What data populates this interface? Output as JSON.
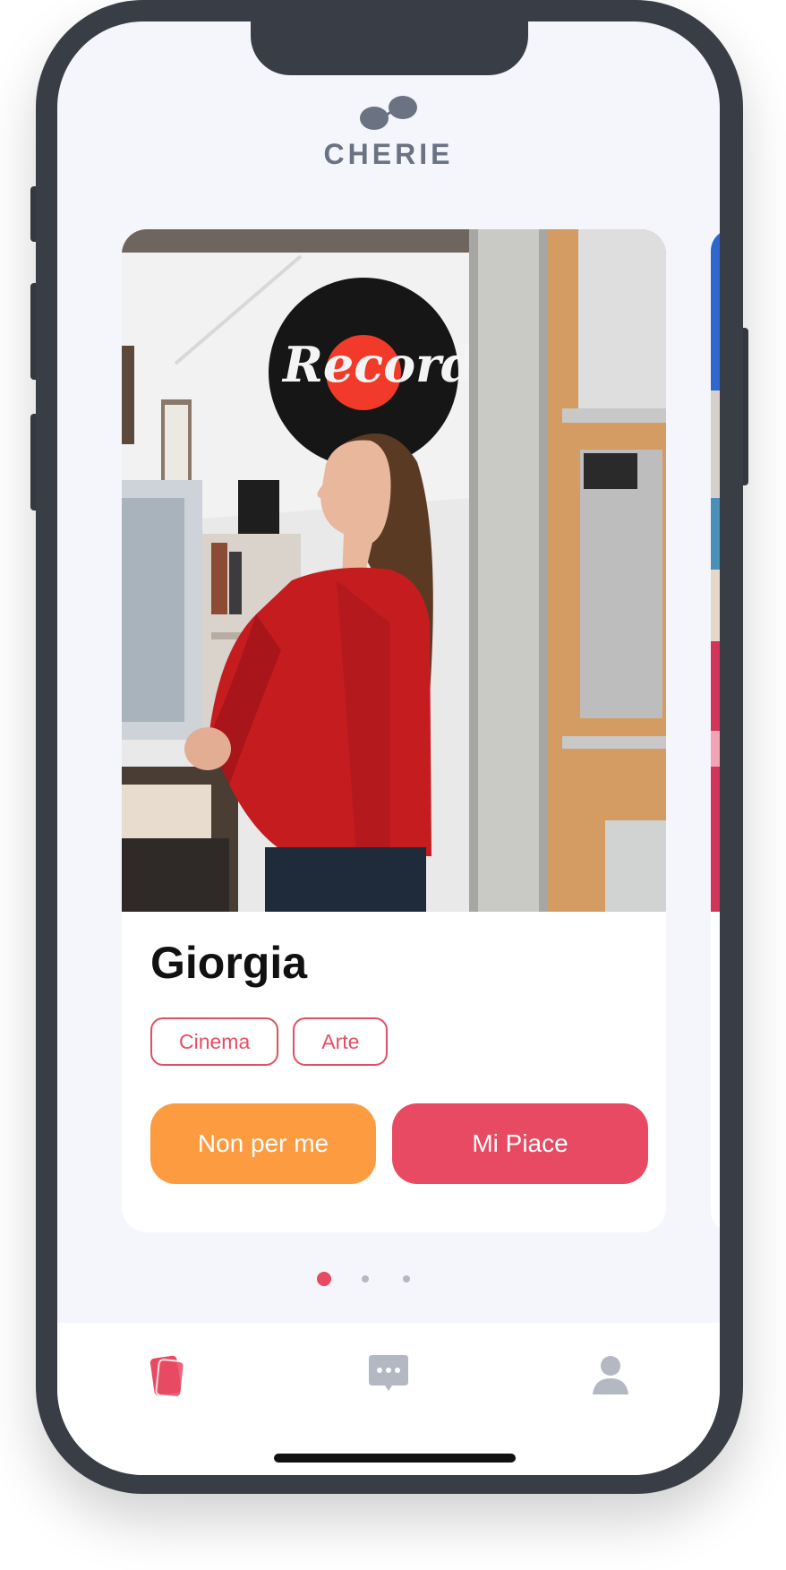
{
  "app": {
    "logo_text": "CHERIE",
    "logo_icon": "cherries-logo-icon"
  },
  "profile": {
    "name": "Giorgia",
    "tags": [
      "Cinema",
      "Arte"
    ],
    "photo_sign_text": "Records"
  },
  "actions": {
    "dislike_label": "Non per me",
    "like_label": "Mi Piace"
  },
  "pagination": {
    "total": 3,
    "active_index": 0
  },
  "tabbar": {
    "items": [
      {
        "icon": "cards-icon",
        "active": true
      },
      {
        "icon": "chat-bubble-icon",
        "active": false
      },
      {
        "icon": "user-icon",
        "active": false
      }
    ]
  },
  "colors": {
    "accent": "#e84a63",
    "secondary": "#fd9b41",
    "frame": "#393d45",
    "inactive_icon": "#b3b8c3",
    "background": "#f4f6fb"
  }
}
